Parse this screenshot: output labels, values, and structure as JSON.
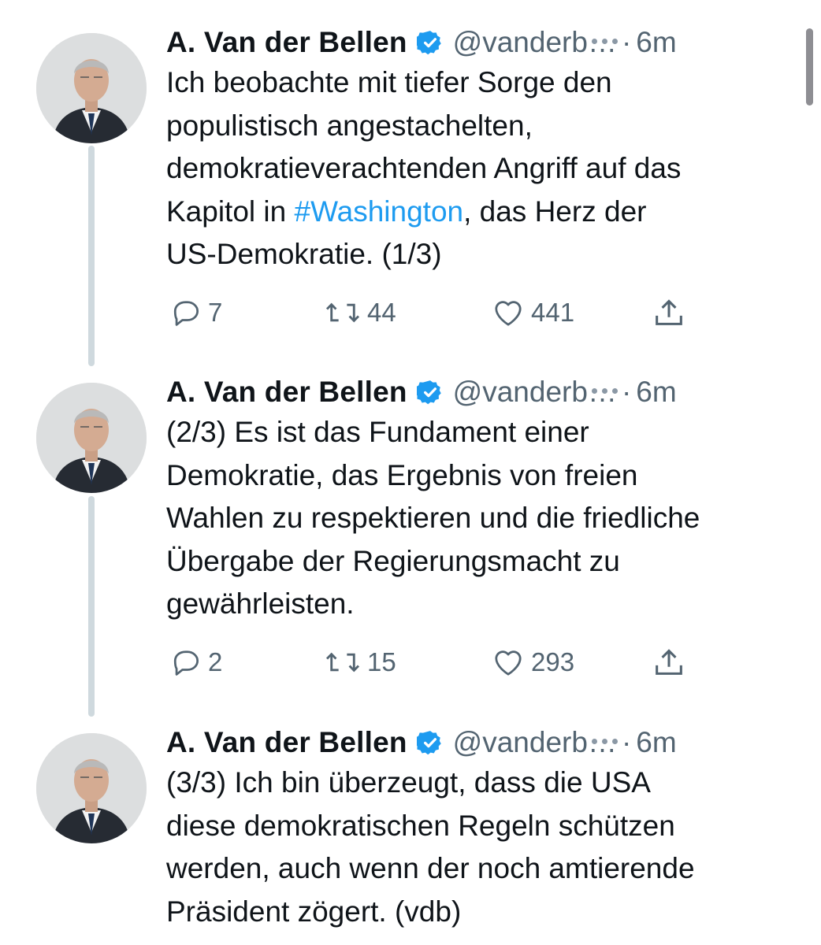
{
  "thread": {
    "tweets": [
      {
        "author_name": "A. Van der Bellen",
        "handle": "@vanderb…",
        "separator": "·",
        "time": "6m",
        "text_lines": [
          [
            "Ich beobachte mit tiefer Sorge den"
          ],
          [
            "populistisch angestachelten,"
          ],
          [
            "demokratieverachtenden Angriff auf das"
          ],
          [
            "Kapitol in ",
            "#Washington",
            ", das Herz der"
          ],
          [
            "US-Demokratie. (1/3)"
          ]
        ],
        "hashtag": "#Washington",
        "replies": "7",
        "retweets": "44",
        "likes": "441"
      },
      {
        "author_name": "A. Van der Bellen",
        "handle": "@vanderb…",
        "separator": "·",
        "time": "6m",
        "text_lines": [
          [
            "(2/3) Es ist das Fundament einer"
          ],
          [
            "Demokratie, das Ergebnis von freien"
          ],
          [
            "Wahlen zu respektieren und die friedliche"
          ],
          [
            "Übergabe der Regierungsmacht zu"
          ],
          [
            "gewährleisten."
          ]
        ],
        "replies": "2",
        "retweets": "15",
        "likes": "293"
      },
      {
        "author_name": "A. Van der Bellen",
        "handle": "@vanderb…",
        "separator": "·",
        "time": "6m",
        "text_lines": [
          [
            "(3/3) Ich bin überzeugt, dass die USA"
          ],
          [
            "diese demokratischen Regeln schützen"
          ],
          [
            "werden, auch wenn der noch amtierende"
          ],
          [
            "Präsident zögert. (vdb)"
          ]
        ]
      }
    ]
  },
  "icons": {
    "verified": "verified-badge-icon",
    "more": "more-horizontal-icon",
    "reply": "reply-bubble-icon",
    "retweet": "retweet-icon",
    "like": "heart-icon",
    "share": "share-upload-icon"
  },
  "colors": {
    "text": "#0f1419",
    "secondary": "#536471",
    "link": "#1d9bf0",
    "verified": "#1d9bf0",
    "connector": "#cfd9de"
  }
}
